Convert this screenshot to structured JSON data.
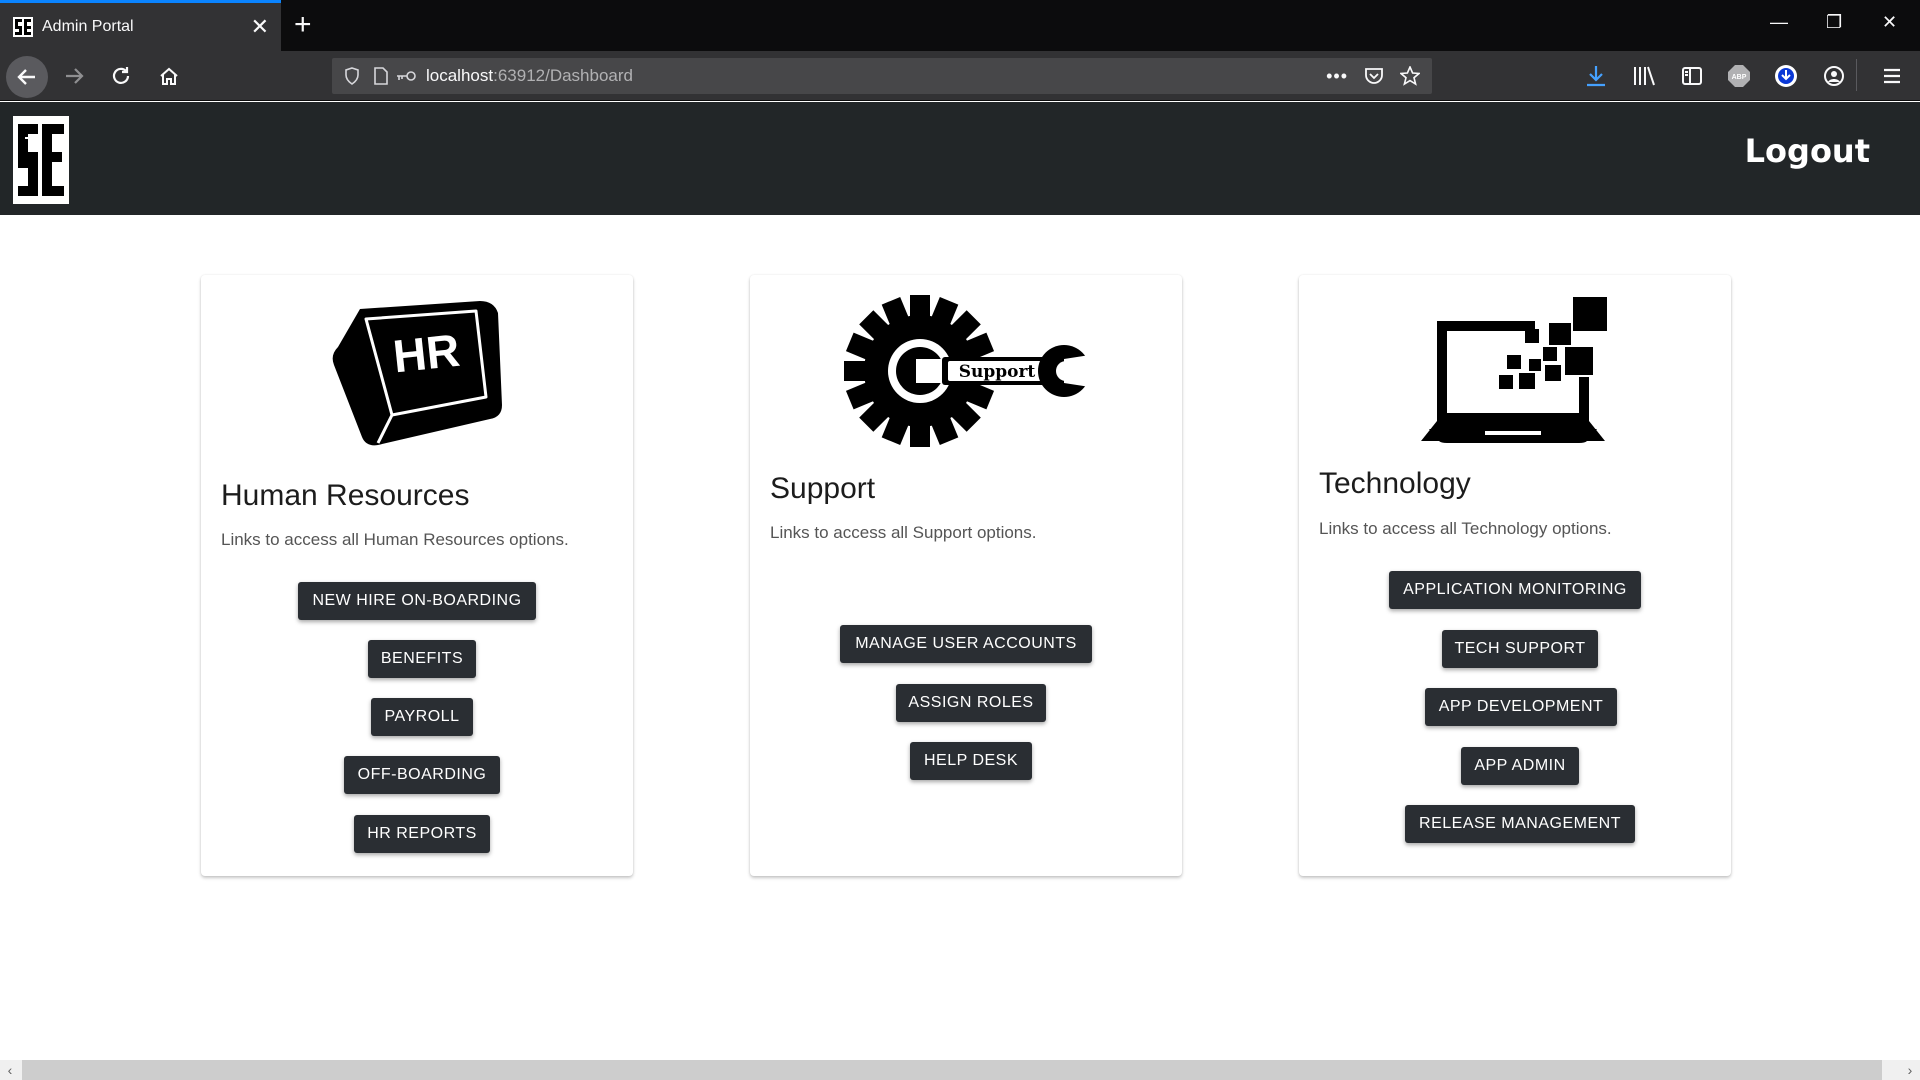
{
  "browser": {
    "tab_title": "Admin Portal",
    "url_host": "localhost",
    "url_path": ":63912/Dashboard"
  },
  "header": {
    "logout_label": "Logout"
  },
  "cards": {
    "hr": {
      "title": "Human Resources",
      "text": "Links to access all Human Resources options.",
      "buttons": [
        "NEW HIRE ON-BOARDING",
        "BENEFITS",
        "PAYROLL",
        "OFF-BOARDING",
        "HR REPORTS"
      ]
    },
    "support": {
      "title": "Support",
      "text": "Links to access all Support options.",
      "icon_label": "Support",
      "buttons": [
        "MANAGE USER ACCOUNTS",
        "ASSIGN ROLES",
        "HELP DESK"
      ]
    },
    "tech": {
      "title": "Technology",
      "text": "Links to access all Technology options.",
      "buttons": [
        "APPLICATION MONITORING",
        "TECH SUPPORT",
        "APP DEVELOPMENT",
        "APP ADMIN",
        "RELEASE MANAGEMENT"
      ]
    }
  }
}
